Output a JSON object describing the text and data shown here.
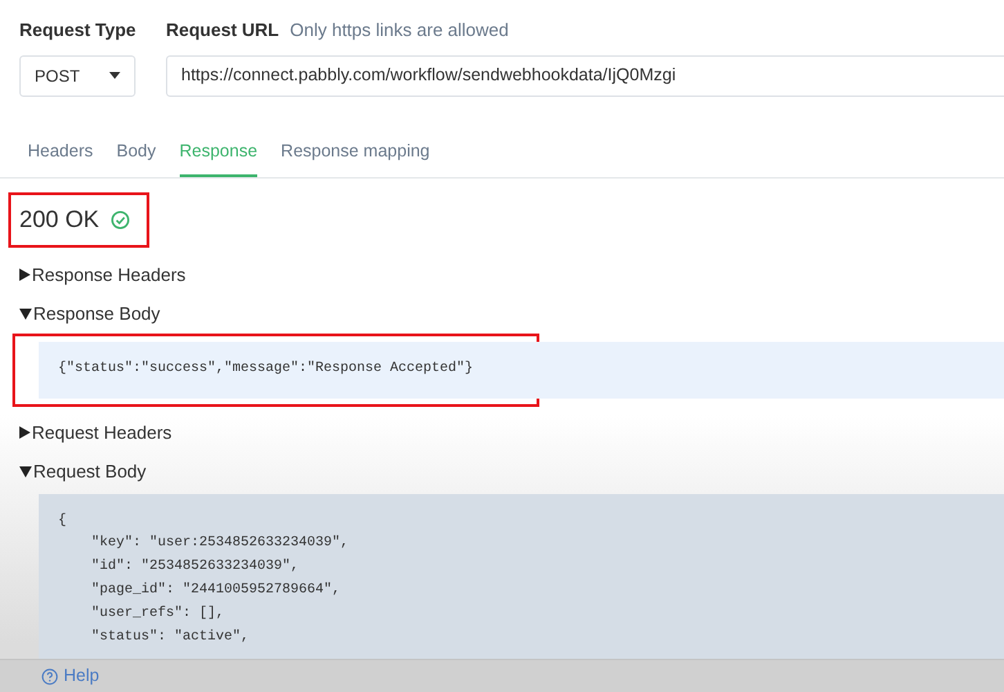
{
  "request_type": {
    "label": "Request Type",
    "value": "POST"
  },
  "request_url": {
    "label": "Request URL",
    "hint": "Only https links are allowed",
    "value": "https://connect.pabbly.com/workflow/sendwebhookdata/IjQ0Mzgi"
  },
  "tabs": [
    {
      "label": "Headers",
      "selected": false
    },
    {
      "label": "Body",
      "selected": false
    },
    {
      "label": "Response",
      "selected": true
    },
    {
      "label": "Response mapping",
      "selected": false
    }
  ],
  "status": {
    "text": "200 OK",
    "ok": true,
    "highlighted": true
  },
  "sections": [
    {
      "title": "Response Headers",
      "expanded": false
    },
    {
      "title": "Response Body",
      "expanded": true,
      "highlighted": true,
      "code": [
        "{\"status\":\"success\",\"message\":\"Response Accepted\"}"
      ]
    },
    {
      "title": "Request Headers",
      "expanded": false
    },
    {
      "title": "Request Body",
      "expanded": true,
      "highlighted": false,
      "code": [
        "{",
        "    \"key\": \"user:2534852633234039\",",
        "    \"id\": \"2534852633234039\",",
        "    \"page_id\": \"2441005952789664\",",
        "    \"user_refs\": [],",
        "    \"status\": \"active\","
      ]
    }
  ],
  "footer": {
    "help": "Help"
  }
}
